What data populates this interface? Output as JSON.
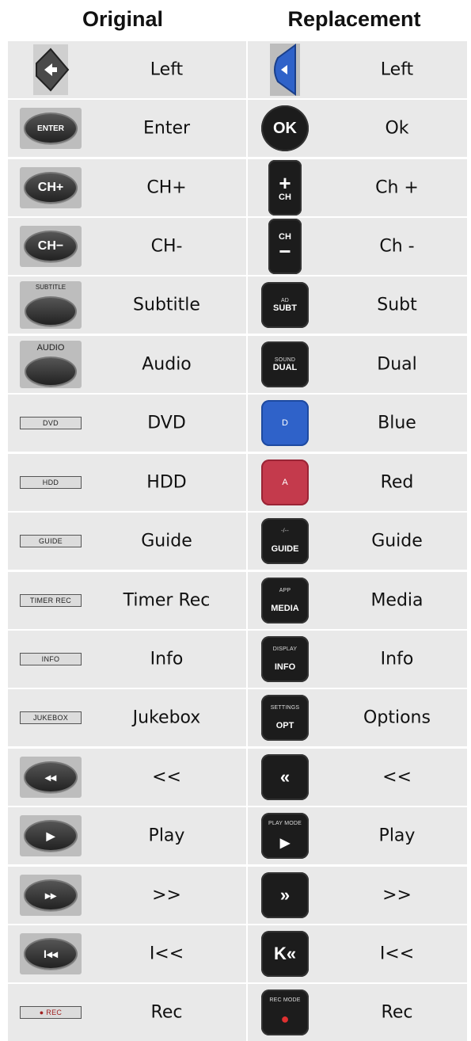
{
  "headers": {
    "original": "Original",
    "replacement": "Replacement"
  },
  "rows": [
    {
      "original": "Left",
      "replacement": "Left",
      "orig_icon": "left-arrow-icon",
      "repl_icon": "blue-left-arrow-icon"
    },
    {
      "original": "Enter",
      "replacement": "Ok",
      "orig_icon": "enter-button-icon",
      "repl_icon": "ok-button-icon",
      "orig_text": "ENTER",
      "repl_text": "OK"
    },
    {
      "original": "CH+",
      "replacement": "Ch +",
      "orig_icon": "ch-plus-button-icon",
      "repl_icon": "ch-plus-rocker-icon",
      "orig_text": "CH+",
      "repl_text": "CH"
    },
    {
      "original": "CH-",
      "replacement": "Ch -",
      "orig_icon": "ch-minus-button-icon",
      "repl_icon": "ch-minus-rocker-icon",
      "orig_text": "CH−",
      "repl_text": "CH"
    },
    {
      "original": "Subtitle",
      "replacement": "Subt",
      "orig_icon": "subtitle-button-icon",
      "repl_icon": "subt-button-icon",
      "orig_text": "SUBTITLE",
      "repl_text": "SUBT",
      "repl_top": "AD"
    },
    {
      "original": "Audio",
      "replacement": "Dual",
      "orig_icon": "audio-button-icon",
      "repl_icon": "dual-button-icon",
      "orig_text": "AUDIO",
      "repl_text": "DUAL",
      "repl_top": "SOUND"
    },
    {
      "original": "DVD",
      "replacement": "Blue",
      "orig_icon": "dvd-strip-icon",
      "repl_icon": "blue-d-button-icon",
      "orig_text": "DVD",
      "repl_text": "D"
    },
    {
      "original": "HDD",
      "replacement": "Red",
      "orig_icon": "hdd-strip-icon",
      "repl_icon": "red-a-button-icon",
      "orig_text": "HDD",
      "repl_text": "A"
    },
    {
      "original": "Guide",
      "replacement": "Guide",
      "orig_icon": "guide-strip-icon",
      "repl_icon": "guide-button-icon",
      "orig_text": "GUIDE",
      "repl_text": "GUIDE",
      "repl_top": "-/--"
    },
    {
      "original": "Timer Rec",
      "replacement": "Media",
      "orig_icon": "timer-rec-strip-icon",
      "repl_icon": "media-button-icon",
      "orig_text": "TIMER REC",
      "repl_text": "MEDIA",
      "repl_top": "APP"
    },
    {
      "original": "Info",
      "replacement": "Info",
      "orig_icon": "info-strip-icon",
      "repl_icon": "info-button-icon",
      "orig_text": "INFO",
      "repl_text": "INFO",
      "repl_top": "DISPLAY"
    },
    {
      "original": "Jukebox",
      "replacement": "Options",
      "orig_icon": "jukebox-strip-icon",
      "repl_icon": "opt-button-icon",
      "orig_text": "JUKEBOX",
      "repl_text": "OPT",
      "repl_top": "SETTINGS"
    },
    {
      "original": "<<",
      "replacement": "<<",
      "orig_icon": "rewind-button-icon",
      "repl_icon": "rewind-button-icon",
      "orig_text": "◂◂",
      "repl_text": "«"
    },
    {
      "original": "Play",
      "replacement": "Play",
      "orig_icon": "play-button-icon",
      "repl_icon": "play-button-icon",
      "orig_text": "▶",
      "repl_text": "▶",
      "repl_top": "PLAY MODE"
    },
    {
      "original": ">>",
      "replacement": ">>",
      "orig_icon": "fast-forward-button-icon",
      "repl_icon": "fast-forward-button-icon",
      "orig_text": "▸▸",
      "repl_text": "»"
    },
    {
      "original": "I<<",
      "replacement": "I<<",
      "orig_icon": "skip-back-button-icon",
      "repl_icon": "skip-back-button-icon",
      "orig_text": "I◂◂",
      "repl_text": "K«"
    },
    {
      "original": "Rec",
      "replacement": "Rec",
      "orig_icon": "rec-strip-icon",
      "repl_icon": "rec-button-icon",
      "orig_text": "● REC",
      "repl_text": "●",
      "repl_top": "REC MODE"
    }
  ],
  "colors": {
    "row_bg": "#e9e9e9",
    "blue_key": "#2f62c9",
    "red_key": "#c43a4c",
    "rec_dot": "#e03030"
  }
}
